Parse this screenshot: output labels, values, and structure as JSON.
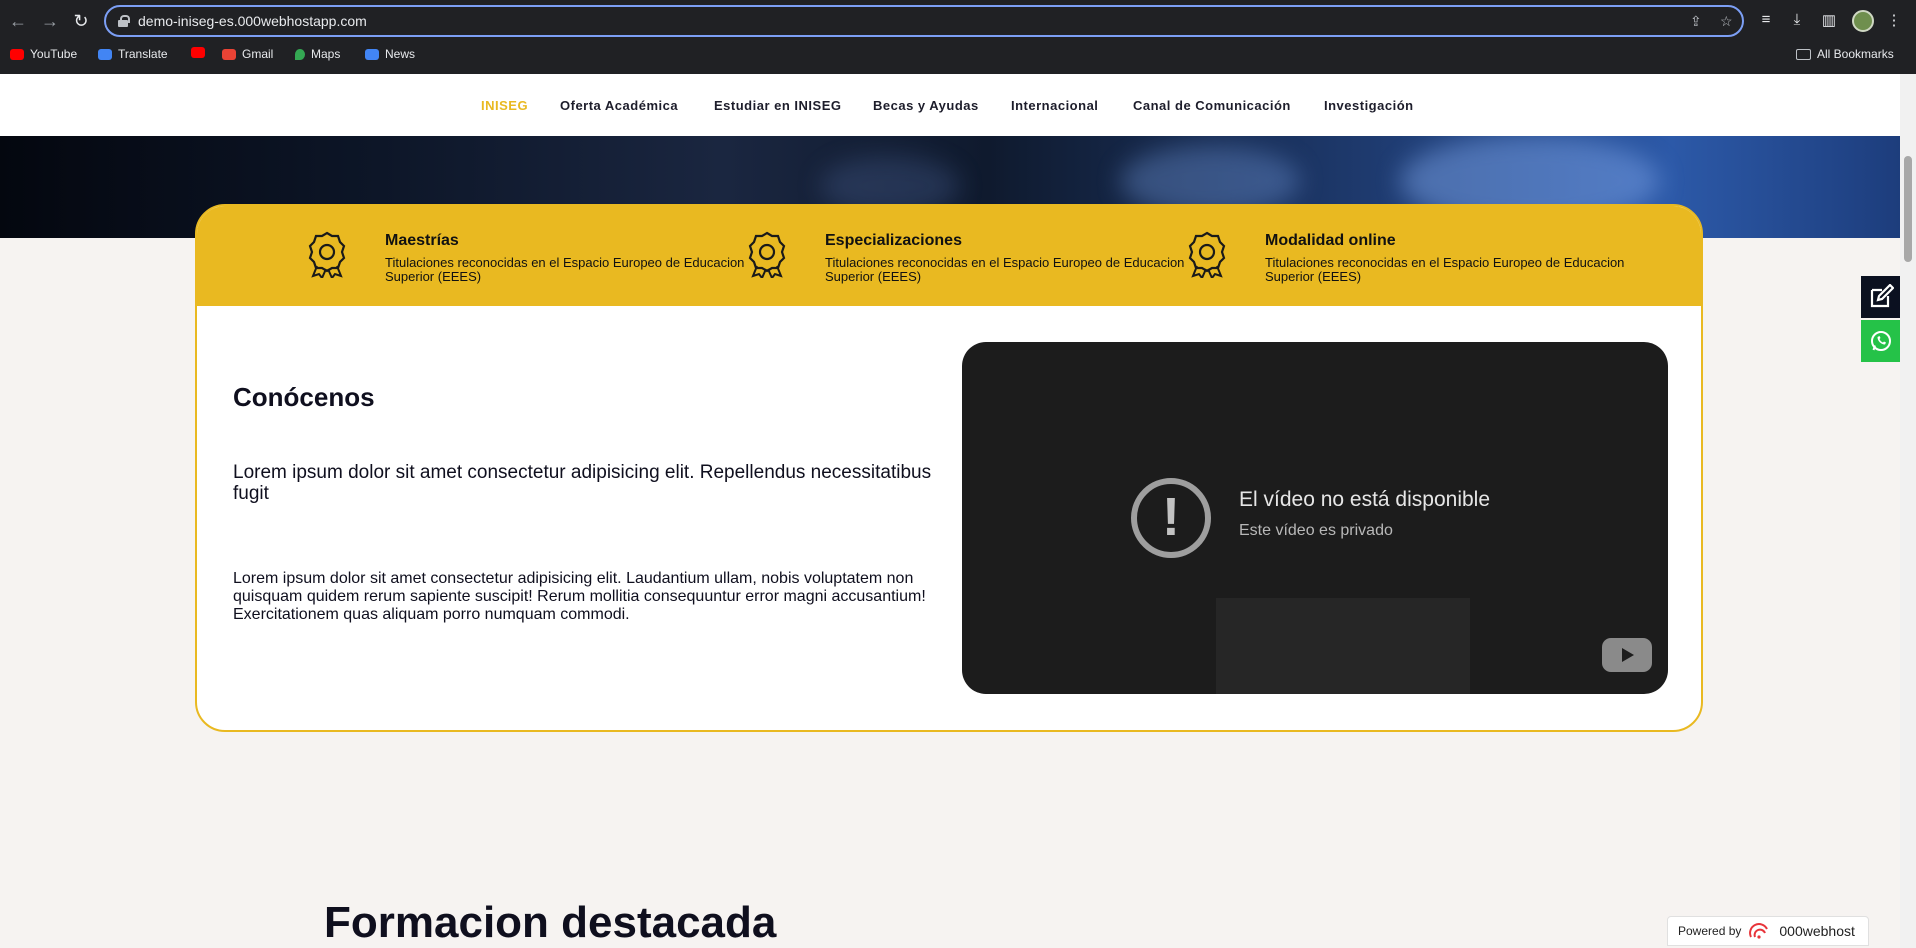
{
  "browser": {
    "url": "demo-iniseg-es.000webhostapp.com",
    "bookmarks": [
      {
        "label": "YouTube",
        "color": "#ff0000"
      },
      {
        "label": "Translate",
        "color": "#4285f4"
      },
      {
        "label": "",
        "color": "#ff0000"
      },
      {
        "label": "Gmail",
        "color": "#ea4335"
      },
      {
        "label": "Maps",
        "color": "#34a853"
      },
      {
        "label": "News",
        "color": "#4285f4"
      }
    ],
    "all_bookmarks": "All Bookmarks"
  },
  "nav": {
    "items": [
      "INISEG",
      "Oferta Académica",
      "Estudiar en INISEG",
      "Becas y Ayudas",
      "Internacional",
      "Canal de Comunicación",
      "Investigación"
    ],
    "active_color": "#e9b921"
  },
  "features": [
    {
      "title": "Maestrías",
      "desc": "Titulaciones reconocidas en el Espacio Europeo de Educacion Superior (EEES)",
      "icon": "award-badge-icon"
    },
    {
      "title": "Especializaciones",
      "desc": "Titulaciones reconocidas en el Espacio Europeo de Educacion Superior (EEES)",
      "icon": "award-badge-icon"
    },
    {
      "title": "Modalidad online",
      "desc": "Titulaciones reconocidas en el Espacio Europeo de Educacion Superior (EEES)",
      "icon": "award-badge-icon"
    }
  ],
  "about": {
    "heading": "Conócenos",
    "lead": "Lorem ipsum dolor sit amet consectetur adipisicing elit. Repellendus necessitatibus fugit",
    "body": "Lorem ipsum dolor sit amet consectetur adipisicing elit. Laudantium ullam, nobis voluptatem non quisquam quidem rerum sapiente suscipit! Rerum mollitia consequuntur error magni accusantium! Exercitationem quas aliquam porro numquam commodi."
  },
  "video": {
    "title": "El vídeo no está disponible",
    "subtitle": "Este vídeo es privado"
  },
  "section": {
    "title": "Formacion destacada"
  },
  "powered": {
    "label": "Powered by",
    "brand": "000webhost"
  },
  "colors": {
    "accent": "#e9b921",
    "whatsapp": "#25c248",
    "dark": "#0b1020"
  }
}
